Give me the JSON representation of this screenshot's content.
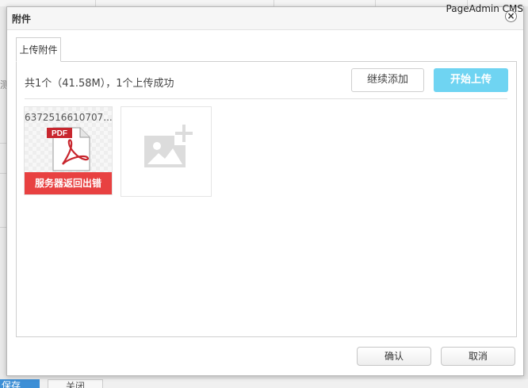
{
  "background": {
    "brand": "PageAdmin CMS",
    "save_label": "保存",
    "close_label": "关闭",
    "left_fragment": "测"
  },
  "dialog": {
    "title": "附件",
    "close_symbol": "×",
    "tab_label": "上传附件",
    "status_text": "共1个（41.58M），1个上传成功",
    "continue_button": "继续添加",
    "start_button": "开始上传",
    "file": {
      "name": "6372516610707...",
      "type_badge": "PDF",
      "error_text": "服务器返回出错"
    },
    "confirm_button": "确认",
    "cancel_button": "取消"
  },
  "colors": {
    "accent": "#6fd4f2",
    "error": "#e84141",
    "pdf_red": "#c8262e"
  },
  "icons": {
    "file_icon": "pdf-file-icon",
    "add_icon": "add-image-icon",
    "close_icon": "close-icon"
  }
}
